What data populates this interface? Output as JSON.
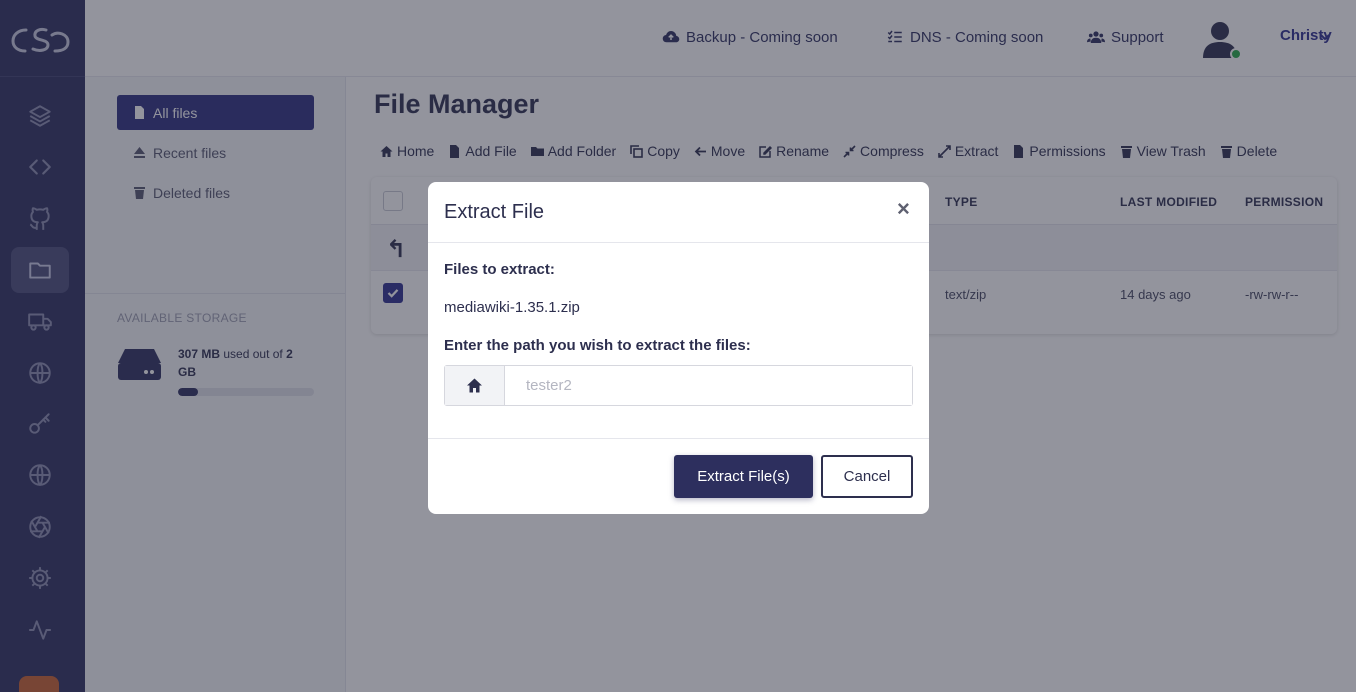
{
  "header": {
    "links": [
      {
        "label": "Backup - Coming soon",
        "icon": "cloud-upload-icon"
      },
      {
        "label": "DNS - Coming soon",
        "icon": "list-icon"
      },
      {
        "label": "Support",
        "icon": "users-icon"
      }
    ],
    "user_name": "Christy"
  },
  "rail": {
    "items": [
      "layers-icon",
      "code-icon",
      "github-icon",
      "folder-icon",
      "truck-icon",
      "globe-icon",
      "key-icon",
      "globe-icon",
      "aperture-icon",
      "gear-icon",
      "activity-icon"
    ],
    "active_index": 3
  },
  "filepanel": {
    "items": [
      {
        "label": "All files",
        "icon": "file-icon"
      },
      {
        "label": "Recent files",
        "icon": "eject-icon"
      },
      {
        "label": "Deleted files",
        "icon": "trash-icon"
      }
    ],
    "storage_label": "AVAILABLE STORAGE",
    "storage_used": "307 MB",
    "storage_used_text": "used out of",
    "storage_total": "2 GB",
    "storage_fraction": 0.15
  },
  "main": {
    "title": "File Manager",
    "toolbar": [
      "Home",
      "Add File",
      "Add Folder",
      "Copy",
      "Move",
      "Rename",
      "Compress",
      "Extract",
      "Permissions",
      "View Trash",
      "Delete"
    ],
    "columns": {
      "type": "TYPE",
      "last_modified": "LAST MODIFIED",
      "permission": "PERMISSION"
    },
    "up_symbol": "↰",
    "row": {
      "type": "text/zip",
      "last_modified": "14 days ago",
      "permission": "-rw-rw-r--"
    }
  },
  "modal": {
    "title": "Extract File",
    "close": "×",
    "files_label": "Files to extract:",
    "file_name": "mediawiki-1.35.1.zip",
    "path_label": "Enter the path you wish to extract the files:",
    "path_placeholder": "tester2",
    "primary_button": "Extract File(s)",
    "cancel_button": "Cancel"
  },
  "colors": {
    "brand": "#2d2f5e",
    "accent": "#2d2f8e",
    "online": "#22a845"
  }
}
